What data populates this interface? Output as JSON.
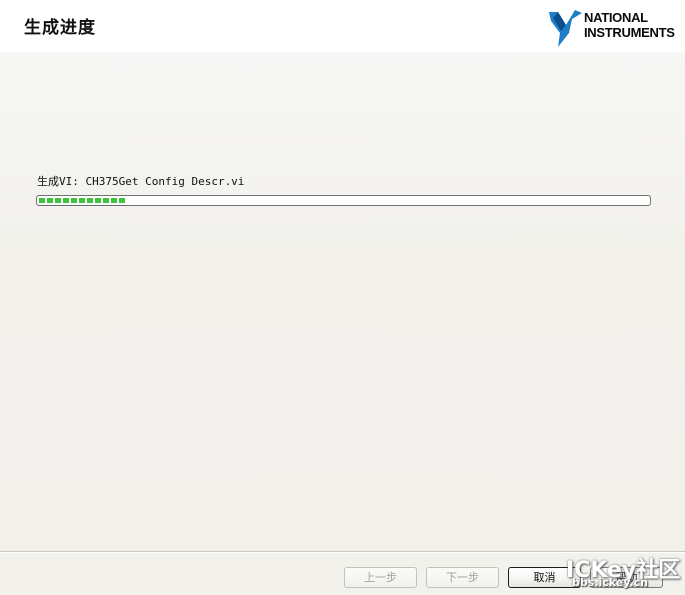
{
  "header": {
    "title": "生成进度",
    "logo": {
      "line1": "NATIONAL",
      "line2": "INSTRUMENTS",
      "icon": "ni-eagle-logo-icon"
    }
  },
  "main": {
    "status_text": "生成VI: CH375Get Config Descr.vi",
    "progress": {
      "fraction": 0.145,
      "color": "#3ec43e"
    }
  },
  "footer": {
    "buttons": [
      {
        "label": "上一步",
        "enabled": false
      },
      {
        "label": "下一步",
        "enabled": false
      },
      {
        "label": "取消",
        "enabled": true,
        "default": true
      },
      {
        "label": "帮助",
        "enabled": true
      }
    ]
  },
  "watermark": {
    "main": "ICKey社区",
    "sub": "bbs.ickey.cn"
  }
}
